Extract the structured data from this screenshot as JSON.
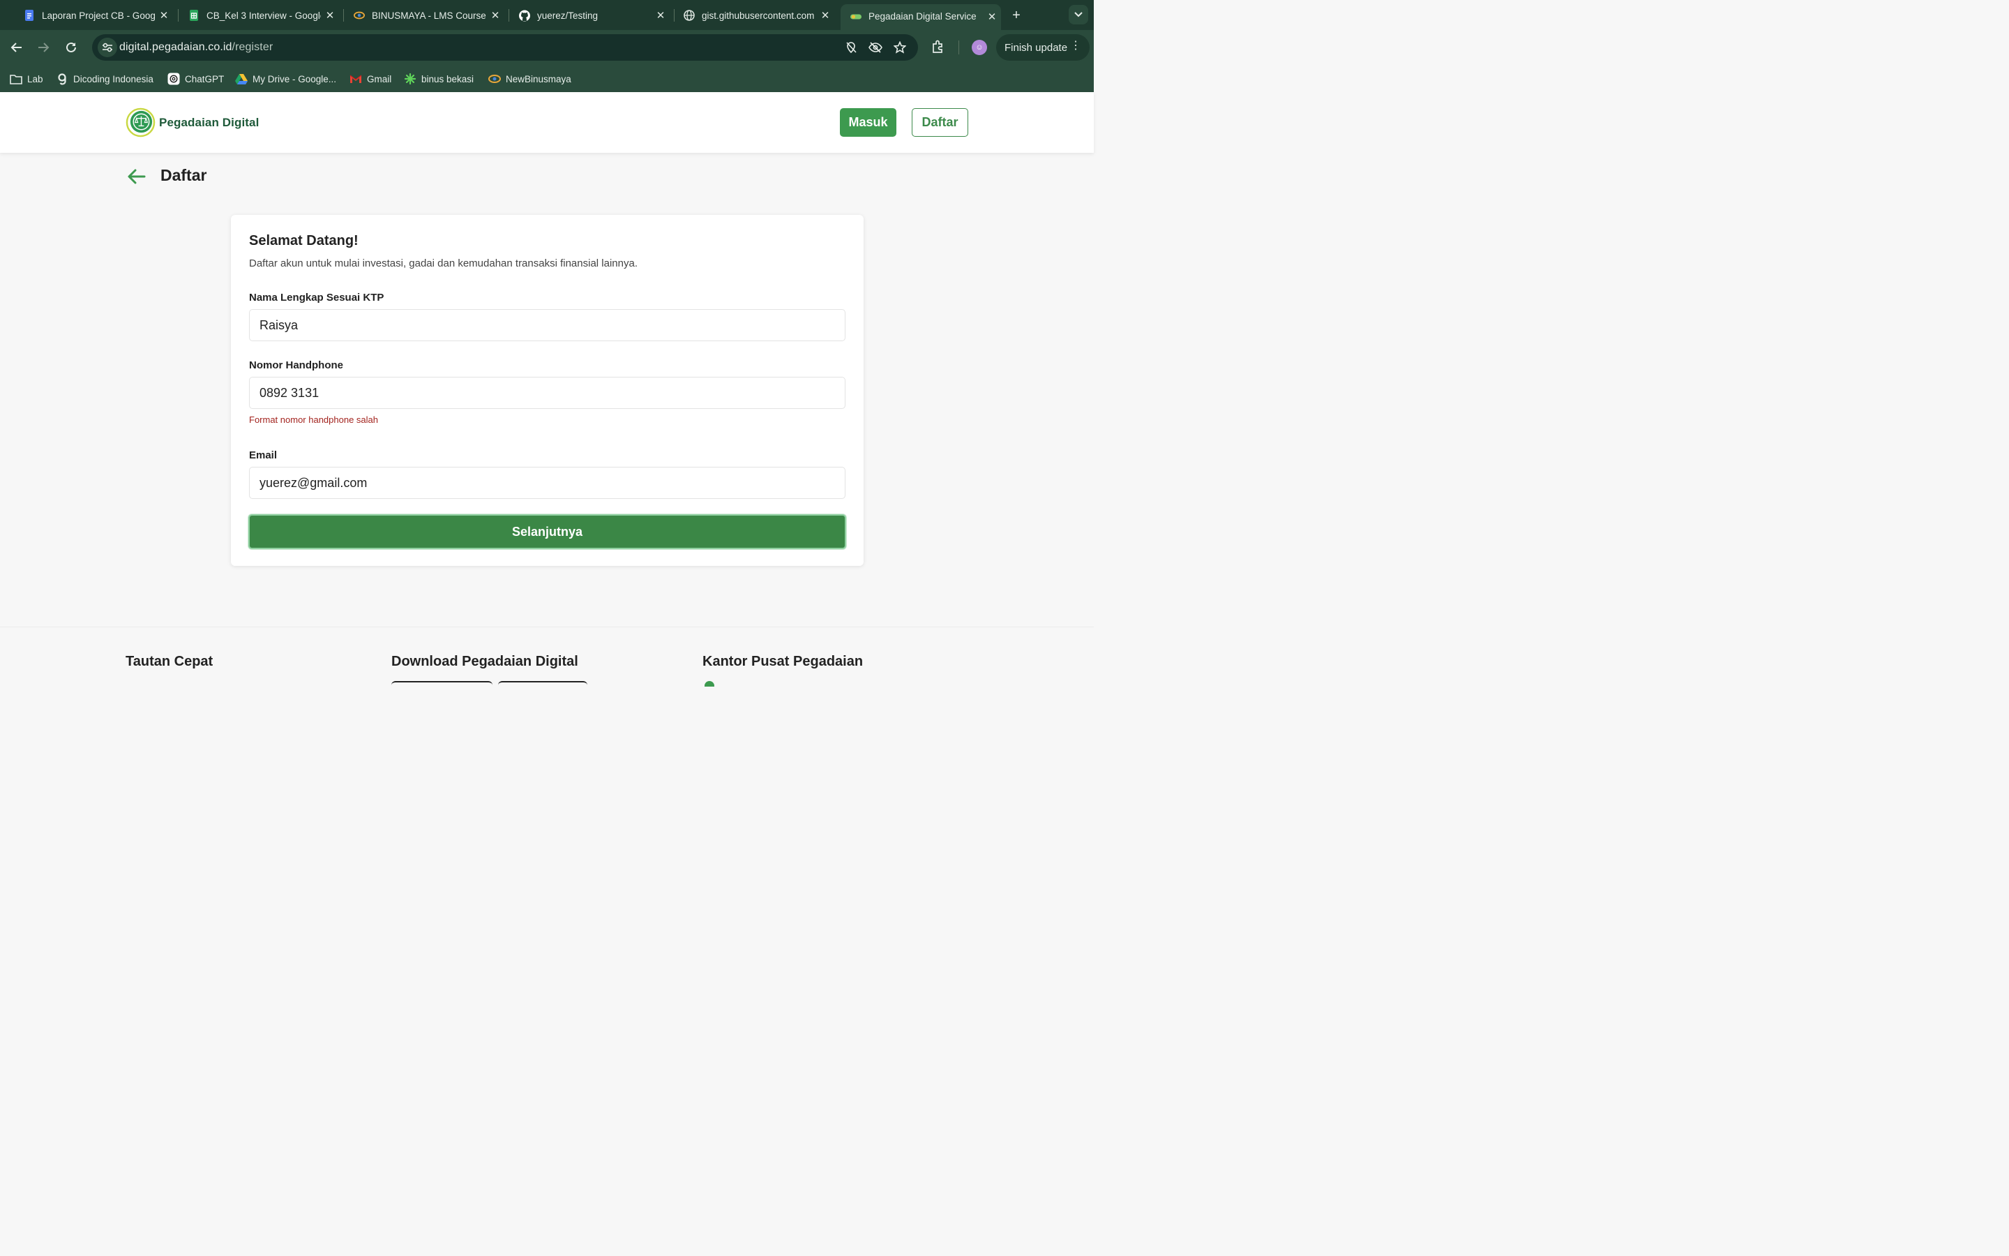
{
  "browser": {
    "tabs": [
      {
        "title": "Laporan Project CB - Google Docs",
        "icon": "docs-icon",
        "color": "#4a7bf0"
      },
      {
        "title": "CB_Kel 3 Interview - Google Sheets",
        "icon": "sheets-icon",
        "color": "#2aa55a"
      },
      {
        "title": "BINUSMAYA - LMS Course",
        "icon": "binusmaya-icon",
        "color": "#e9a73b"
      },
      {
        "title": "yuerez/Testing",
        "icon": "github-icon",
        "color": "#ffffff"
      },
      {
        "title": "gist.githubusercontent.com",
        "icon": "globe-icon",
        "color": "#dfe7e2"
      },
      {
        "title": "Pegadaian Digital Service",
        "icon": "pegadaian-icon",
        "color": "#7cc96a",
        "active": true
      }
    ],
    "url_host": "digital.pegadaian.co.id",
    "url_path": "/register",
    "finish_update": "Finish update",
    "bookmarks": [
      {
        "label": "Lab",
        "icon": "folder-icon"
      },
      {
        "label": "Dicoding Indonesia",
        "icon": "dicoding-icon"
      },
      {
        "label": "ChatGPT",
        "icon": "chatgpt-icon"
      },
      {
        "label": "My Drive - Google...",
        "icon": "drive-icon"
      },
      {
        "label": "Gmail",
        "icon": "gmail-icon"
      },
      {
        "label": "binus bekasi",
        "icon": "binus-bekasi-icon"
      },
      {
        "label": "NewBinusmaya",
        "icon": "binusmaya-icon"
      }
    ]
  },
  "header": {
    "logo_text": "Pegadaian Digital",
    "login_label": "Masuk",
    "register_label": "Daftar",
    "brand_color": "#3d9a4f"
  },
  "page": {
    "title": "Daftar"
  },
  "form": {
    "heading": "Selamat Datang!",
    "subtitle": "Daftar akun untuk mulai investasi, gadai dan kemudahan transaksi finansial lainnya.",
    "name_label": "Nama Lengkap Sesuai KTP",
    "name_value": "Raisya",
    "phone_label": "Nomor Handphone",
    "phone_value": "0892 3131",
    "phone_error": "Format nomor handphone salah",
    "email_label": "Email",
    "email_value": "yuerez@gmail.com",
    "submit_label": "Selanjutnya"
  },
  "footer": {
    "col1": "Tautan Cepat",
    "col2": "Download Pegadaian Digital",
    "col3": "Kantor Pusat Pegadaian"
  }
}
